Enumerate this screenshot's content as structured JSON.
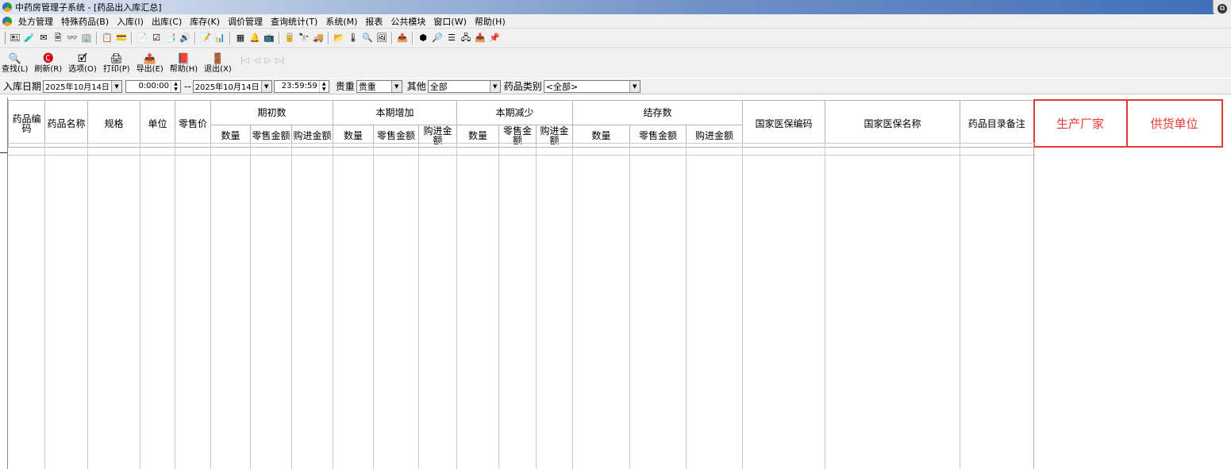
{
  "window": {
    "title": "中药房管理子系统 - [药品出入库汇总]",
    "restore_glyph": "⧉"
  },
  "menu": {
    "items": [
      "处方管理",
      "特殊药品(B)",
      "入库(I)",
      "出库(C)",
      "库存(K)",
      "调价管理",
      "查询统计(T)",
      "系统(M)",
      "报表",
      "公共模块",
      "窗口(W)",
      "帮助(H)"
    ]
  },
  "icon_toolbar": {
    "icons": [
      "🖭",
      "🧪",
      "✉",
      "🗎",
      "👓",
      "🏢",
      "📋",
      "💳",
      "📄",
      "☑",
      "📑",
      "🔊",
      "📝",
      "📊",
      "▦",
      "🔔",
      "📺",
      "🥫",
      "🔭",
      "🚚",
      "📂",
      "🌡",
      "🔍",
      "🖼",
      "📤",
      "⬢",
      "🔎",
      "☰",
      "🖧",
      "📥",
      "📌"
    ]
  },
  "commands": [
    {
      "icon": "🔍",
      "label": "查找(L)"
    },
    {
      "icon": "🅒",
      "label": "刷新(R)"
    },
    {
      "icon": "🗹",
      "label": "选项(O)"
    },
    {
      "icon": "🖨",
      "label": "打印(P)"
    },
    {
      "icon": "📤",
      "label": "导出(E)"
    },
    {
      "icon": "📕",
      "label": "帮助(H)"
    },
    {
      "icon": "🚪",
      "label": "退出(X)"
    }
  ],
  "nav_arrows": [
    "|◁",
    "◁",
    "▷",
    "▷|"
  ],
  "filters": {
    "date_label": "入库日期",
    "start_date": "2025年10月14日",
    "start_time": "0:00:00",
    "separator": "--",
    "end_date": "2025年10月14日",
    "end_time": "23:59:59",
    "grade_label": "贵重",
    "grade_value": "贵重",
    "other_label": "其他",
    "other_value": "全部",
    "category_label": "药品类别",
    "category_value": "<全部>"
  },
  "table": {
    "columns": {
      "code": "药品编码",
      "name": "药品名称",
      "spec": "规格",
      "unit": "单位",
      "retail_price": "零售价",
      "national_code": "国家医保编码",
      "national_name": "国家医保名称",
      "remark": "药品目录备注",
      "manufacturer": "生产厂家",
      "supplier": "供货单位"
    },
    "groups": {
      "opening": "期初数",
      "increase": "本期增加",
      "decrease": "本期减少",
      "closing": "结存数"
    },
    "sub": {
      "qty": "数量",
      "retail_amt": "零售金额",
      "purchase_amt": "购进金额"
    }
  }
}
